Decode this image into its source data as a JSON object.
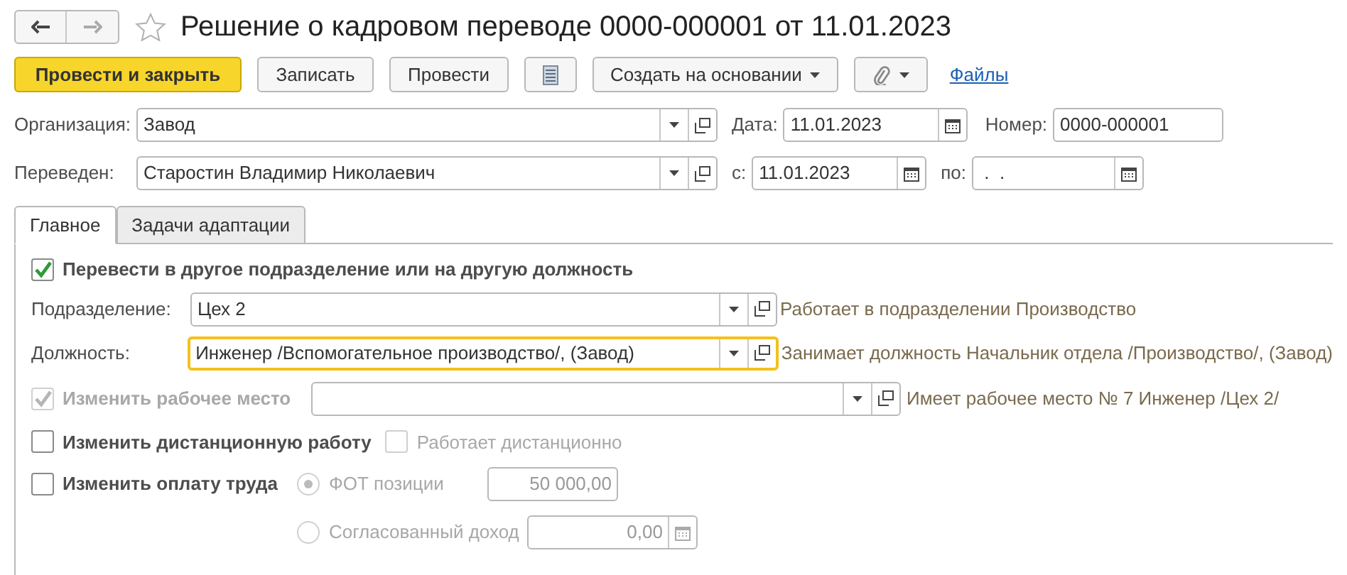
{
  "title": "Решение о кадровом переводе 0000-000001 от 11.01.2023",
  "toolbar": [
    {
      "kind": "primary",
      "label": "Провести и закрыть"
    },
    {
      "kind": "button",
      "label": "Записать"
    },
    {
      "kind": "button",
      "label": "Провести"
    },
    {
      "kind": "list"
    },
    {
      "kind": "menu",
      "label": "Создать на основании"
    },
    {
      "kind": "clip"
    },
    {
      "kind": "link",
      "label": "Файлы"
    }
  ],
  "organization": {
    "label": "Организация:",
    "value": "Завод"
  },
  "date": {
    "label": "Дата:",
    "value": "11.01.2023"
  },
  "number": {
    "label": "Номер:",
    "value": "0000-000001"
  },
  "employee": {
    "label": "Переведен:",
    "value": "Старостин Владимир Николаевич"
  },
  "from": {
    "label": "с:",
    "value": "11.01.2023"
  },
  "to": {
    "label": "по:",
    "value": " .  ."
  },
  "tabs": [
    {
      "label": "Главное",
      "selected": true
    },
    {
      "label": "Задачи адаптации",
      "selected": false
    }
  ],
  "transfer": {
    "label": "Перевести в другое подразделение или на другую должность",
    "checked": true
  },
  "department": {
    "label": "Подразделение:",
    "value": "Цех 2",
    "hint": "Работает в подразделении Производство"
  },
  "position": {
    "label": "Должность:",
    "value": "Инженер /Вспомогательное производство/, (Завод)",
    "hint": "Занимает должность Начальник отдела /Производство/, (Завод)",
    "focused": true
  },
  "workplace": {
    "label": "Изменить рабочее место",
    "checked": true,
    "disabled": true,
    "hint": "Имеет рабочее место № 7 Инженер /Цех 2/"
  },
  "remote": {
    "label": "Изменить дистанционную работу",
    "checked": false
  },
  "remote_flag": {
    "label": "Работает дистанционно",
    "checked": false,
    "disabled": true
  },
  "pay": {
    "label": "Изменить оплату труда",
    "checked": false
  },
  "pay_options": [
    {
      "kind": "plain",
      "label": "ФОТ позиции",
      "value": "50 000,00",
      "selected": true,
      "disabled": true
    },
    {
      "kind": "calculator",
      "label": "Согласованный доход",
      "value": "0,00",
      "selected": false,
      "disabled": true
    }
  ]
}
